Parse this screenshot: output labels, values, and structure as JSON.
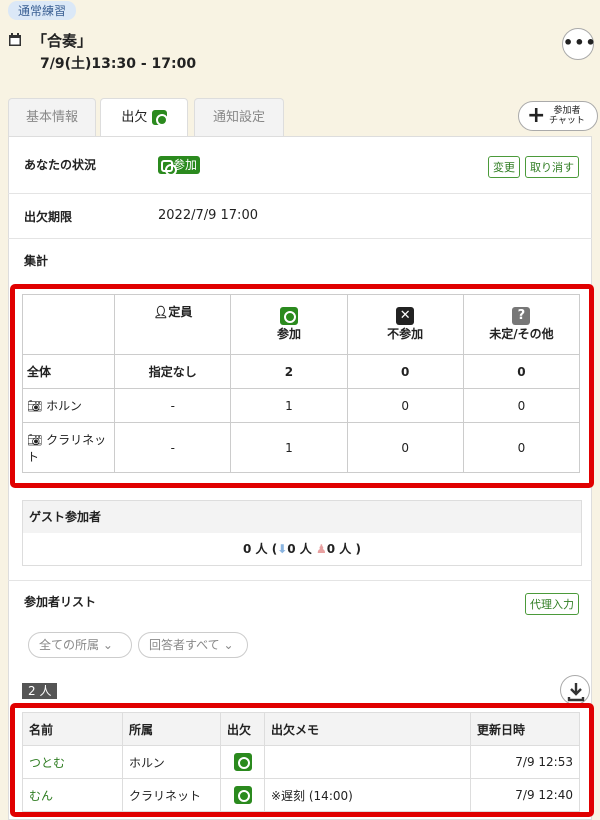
{
  "event": {
    "tag": "通常練習",
    "title": "「合奏」",
    "datetime": "7/9(土)13:30 - 17:00"
  },
  "tabs": [
    {
      "label": "基本情報"
    },
    {
      "label": "出欠"
    },
    {
      "label": "通知設定"
    }
  ],
  "chat_button": {
    "line1": "参加者",
    "line2": "チャット"
  },
  "status": {
    "label": "あなたの状況",
    "value": "参加",
    "change": "変更",
    "cancel": "取り消す"
  },
  "deadline": {
    "label": "出欠期限",
    "value": "2022/7/9 17:00"
  },
  "summary": {
    "label": "集計",
    "h_capacity": "定員",
    "h_join": "参加",
    "h_absent": "不参加",
    "h_other": "未定/その他",
    "rows": [
      {
        "name": "全体",
        "capacity": "指定なし",
        "join": "2",
        "absent": "0",
        "other": "0"
      },
      {
        "name": "ホルン",
        "capacity": "-",
        "join": "1",
        "absent": "0",
        "other": "0"
      },
      {
        "name": "クラリネット",
        "capacity": "-",
        "join": "1",
        "absent": "0",
        "other": "0"
      }
    ]
  },
  "guest": {
    "label": "ゲスト参加者",
    "total": "0 人 (",
    "male": "0 人",
    "female": "0 人 )"
  },
  "list": {
    "label": "参加者リスト",
    "proxy": "代理入力",
    "filter_group": "全ての所属",
    "filter_answer": "回答者すべて",
    "count": "2 人",
    "headers": {
      "name": "名前",
      "group": "所属",
      "att": "出欠",
      "memo": "出欠メモ",
      "updated": "更新日時"
    },
    "rows": [
      {
        "name": "つとむ",
        "group": "ホルン",
        "memo": "",
        "updated": "7/9 12:53"
      },
      {
        "name": "むん",
        "group": "クラリネット",
        "memo": "※遅刻 (14:00)",
        "updated": "7/9 12:40"
      }
    ]
  }
}
